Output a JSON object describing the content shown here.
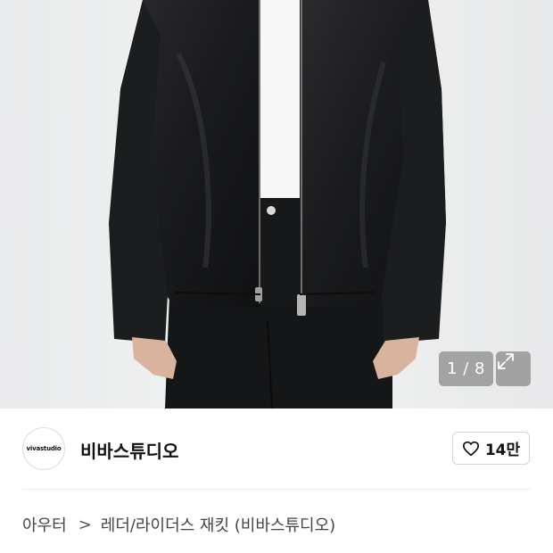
{
  "gallery": {
    "counter": "1 / 8",
    "icon": "expand-icon"
  },
  "brand": {
    "logo_text": "vivastudio",
    "name": "비바스튜디오"
  },
  "like": {
    "icon": "heart-outline-icon",
    "count": "14만"
  },
  "breadcrumb": {
    "category": "아우터",
    "separator": ">",
    "product_title": "레더/라이더스 재킷 (비바스튜디오)"
  }
}
